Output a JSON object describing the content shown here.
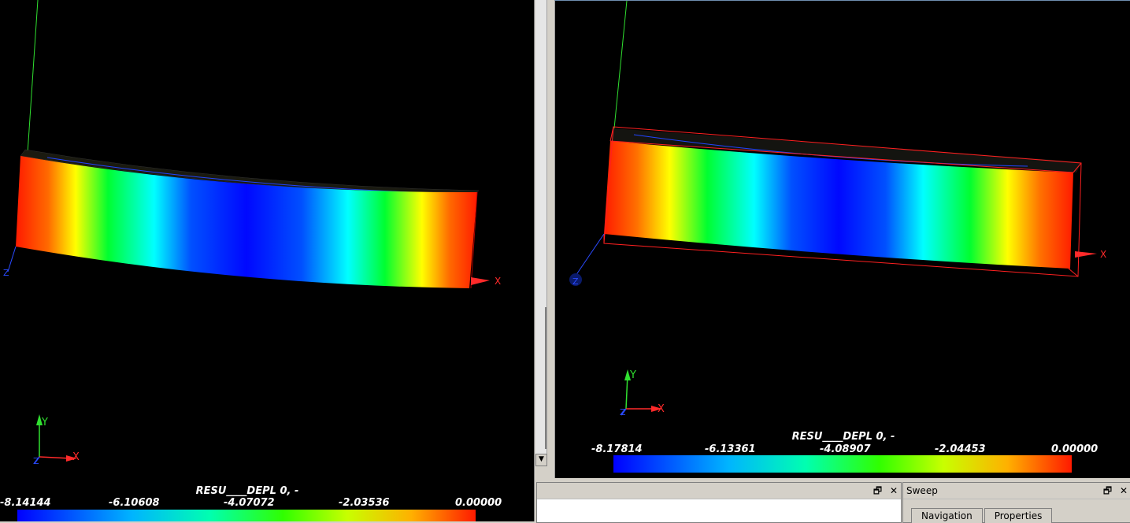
{
  "viewports": {
    "left": {
      "legend": {
        "title": "RESU____DEPL 0, -",
        "ticks": [
          "-8.14144",
          "-6.10608",
          "-4.07072",
          "-2.03536",
          "0.00000"
        ]
      },
      "axes": {
        "x": "X",
        "y": "Y",
        "z": "Z"
      }
    },
    "right": {
      "legend": {
        "title": "RESU____DEPL 0, -",
        "ticks": [
          "-8.17814",
          "-6.13361",
          "-4.08907",
          "-2.04453",
          "0.00000"
        ]
      },
      "axes": {
        "x": "X",
        "y": "Y",
        "z": "Z"
      }
    }
  },
  "colors": {
    "background": "#000000",
    "colormap": [
      "#ff0000",
      "#ffff00",
      "#00ff00",
      "#00ffff",
      "#0000ff"
    ],
    "bounding_box": "#ff2020",
    "axis_x": "#ff2a2a",
    "axis_y": "#30e030",
    "axis_z": "#2a4aff"
  },
  "panels": {
    "bottom": {
      "title": "",
      "restore_icon": "restore-icon",
      "close_icon": "close-icon",
      "restore_glyph": "🗗",
      "close_glyph": "✕"
    },
    "sweep": {
      "title": "Sweep",
      "restore_glyph": "🗗",
      "close_glyph": "✕",
      "tabs": [
        "Navigation",
        "Properties"
      ]
    }
  }
}
